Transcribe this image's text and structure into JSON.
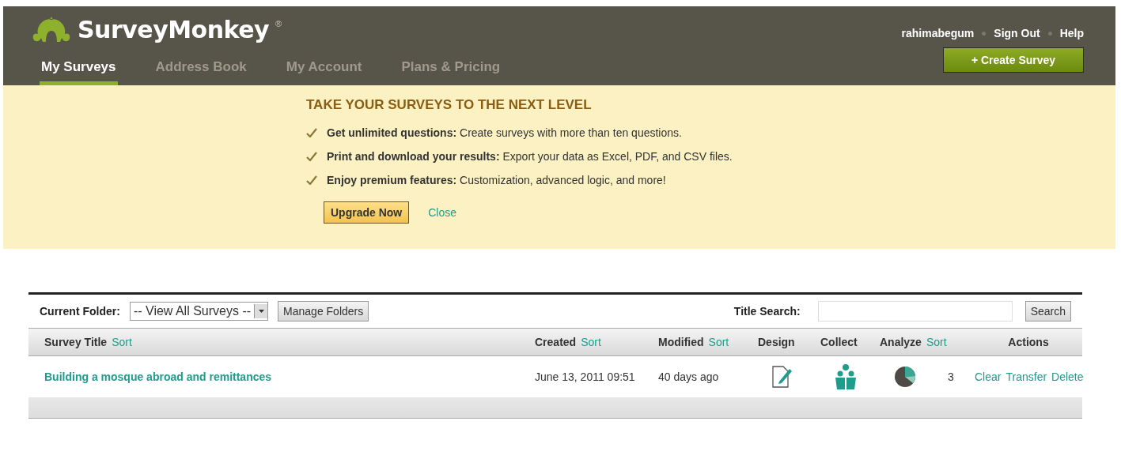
{
  "header": {
    "logo": "SurveyMonkey",
    "logo_mark": "®",
    "user_links": [
      "rahimabegum",
      "Sign Out",
      "Help"
    ],
    "create_button": "+ Create Survey"
  },
  "nav_tabs": [
    {
      "label": "My Surveys",
      "selected": true
    },
    {
      "label": "Address Book",
      "selected": false
    },
    {
      "label": "My Account",
      "selected": false
    },
    {
      "label": "Plans & Pricing",
      "selected": false
    }
  ],
  "banner": {
    "title": "TAKE YOUR SURVEYS TO THE NEXT LEVEL",
    "features": [
      "**Get unlimited questions:** Create surveys with more than ten questions.",
      "**Print and download your results:** Export your data as Excel, PDF, and CSV files.",
      "**Enjoy premium features:** Customization, advanced logic, and more!"
    ],
    "upgrade_button": "Upgrade Now",
    "close_link": "Close"
  },
  "toolbar": {
    "folder_label": "Current Folder:",
    "folder_value": "-- View All Surveys --",
    "manage_button": "Manage Folders",
    "search_label": "Title Search:",
    "search_button": "Search"
  },
  "table": {
    "columns": [
      {
        "label": "Survey Title",
        "sort": "Sort"
      },
      {
        "label": "Created",
        "sort": "Sort"
      },
      {
        "label": "Modified",
        "sort": "Sort"
      },
      {
        "label": "Design"
      },
      {
        "label": "Collect"
      },
      {
        "label": "Analyze",
        "sort": "Sort"
      },
      {
        "label": "Actions"
      }
    ],
    "rows": [
      {
        "title": "Building a mosque abroad and remittances",
        "created": "June 13, 2011 09:51",
        "modified": "40 days ago",
        "responses": "3",
        "actions": [
          "Clear",
          "Transfer",
          "Delete"
        ]
      }
    ]
  }
}
